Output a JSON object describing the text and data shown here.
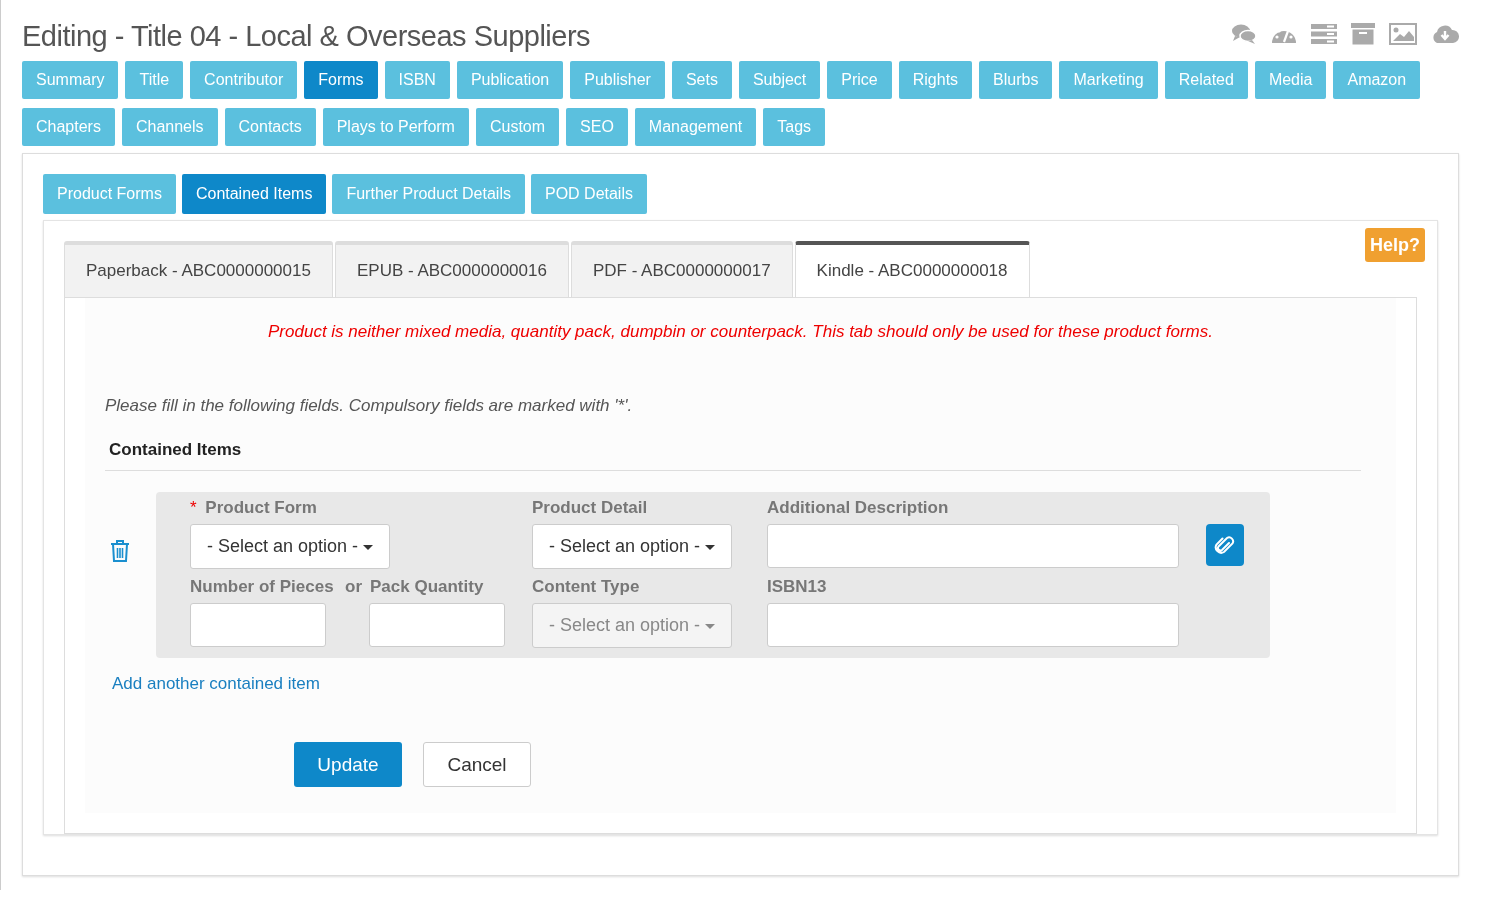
{
  "page_title": "Editing - Title 04 - Local & Overseas Suppliers",
  "main_tabs": [
    {
      "label": "Summary",
      "selected": false
    },
    {
      "label": "Title",
      "selected": false
    },
    {
      "label": "Contributor",
      "selected": false
    },
    {
      "label": "Forms",
      "selected": true
    },
    {
      "label": "ISBN",
      "selected": false
    },
    {
      "label": "Publication",
      "selected": false
    },
    {
      "label": "Publisher",
      "selected": false
    },
    {
      "label": "Sets",
      "selected": false
    },
    {
      "label": "Subject",
      "selected": false
    },
    {
      "label": "Price",
      "selected": false
    },
    {
      "label": "Rights",
      "selected": false
    },
    {
      "label": "Blurbs",
      "selected": false
    },
    {
      "label": "Marketing",
      "selected": false
    },
    {
      "label": "Related",
      "selected": false
    },
    {
      "label": "Media",
      "selected": false
    },
    {
      "label": "Amazon",
      "selected": false
    },
    {
      "label": "Chapters",
      "selected": false
    },
    {
      "label": "Channels",
      "selected": false
    },
    {
      "label": "Contacts",
      "selected": false
    },
    {
      "label": "Plays to Perform",
      "selected": false
    },
    {
      "label": "Custom",
      "selected": false
    },
    {
      "label": "SEO",
      "selected": false
    },
    {
      "label": "Management",
      "selected": false
    },
    {
      "label": "Tags",
      "selected": false
    }
  ],
  "sub_tabs": [
    {
      "label": "Product Forms",
      "selected": false
    },
    {
      "label": "Contained Items",
      "selected": true
    },
    {
      "label": "Further Product Details",
      "selected": false
    },
    {
      "label": "POD Details",
      "selected": false
    }
  ],
  "help_button": "Help?",
  "product_tabs": [
    {
      "label": "Paperback - ABC0000000015",
      "selected": false
    },
    {
      "label": "EPUB - ABC0000000016",
      "selected": false
    },
    {
      "label": "PDF - ABC0000000017",
      "selected": false
    },
    {
      "label": "Kindle - ABC0000000018",
      "selected": true
    }
  ],
  "warning": "Product is neither mixed media, quantity pack, dumpbin or counterpack. This tab should only be used for these product forms.",
  "instructions": "Please fill in the following fields. Compulsory fields are marked with '*'.",
  "section_title": "Contained Items",
  "item": {
    "product_form": {
      "label": "Product Form",
      "required_mark": "*",
      "value": "- Select an option -",
      "disabled": false
    },
    "product_detail": {
      "label": "Product Detail",
      "value": "- Select an option -",
      "disabled": false
    },
    "additional_description": {
      "label": "Additional Description"
    },
    "number_of_pieces": {
      "label": "Number of Pieces"
    },
    "or_label": "or",
    "pack_quantity": {
      "label": "Pack Quantity"
    },
    "content_type": {
      "label": "Content Type",
      "value": "- Select an option -",
      "disabled": true
    },
    "isbn13": {
      "label": "ISBN13"
    }
  },
  "add_link": "Add another contained item",
  "buttons": {
    "update": "Update",
    "cancel": "Cancel"
  }
}
